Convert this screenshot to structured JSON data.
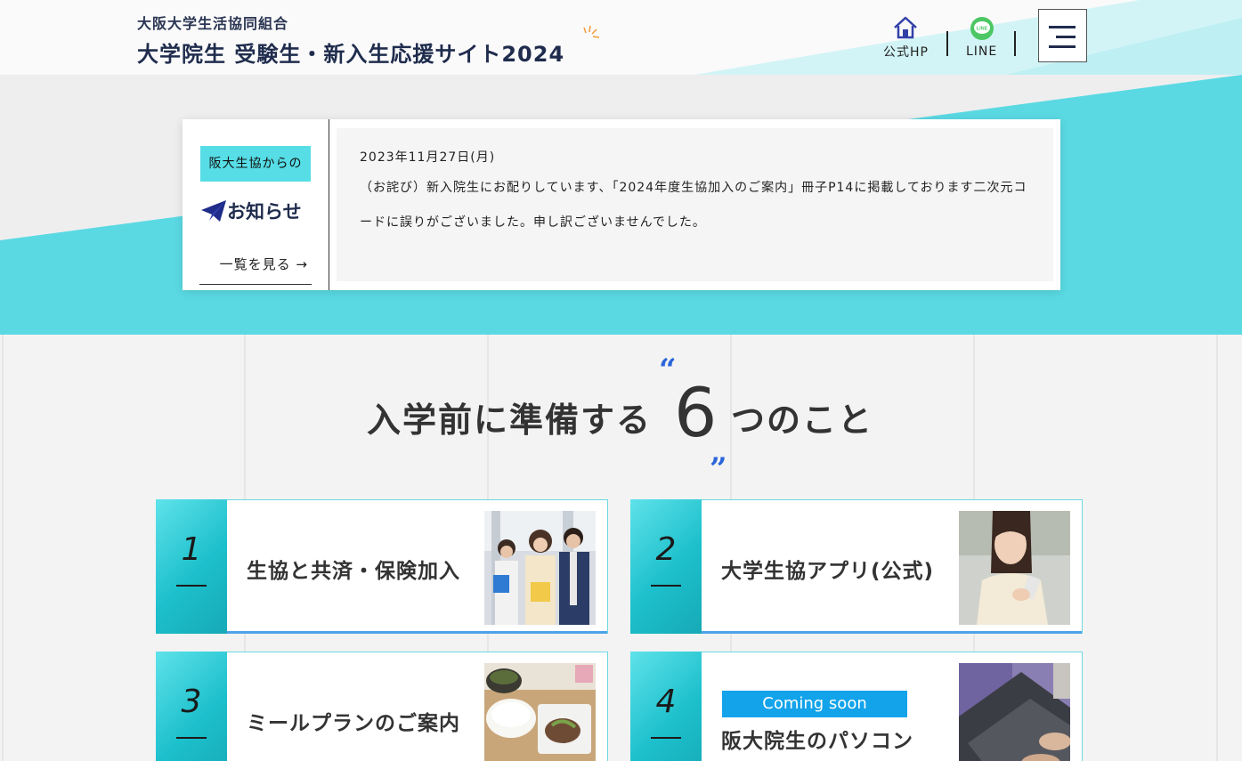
{
  "header": {
    "org_name": "大阪大学生活協同組合",
    "site_title": "大学院生 受験生・新入生応援サイト2024",
    "nav": {
      "official_hp_label": "公式HP",
      "line_label": "LINE",
      "line_icon_text": "LINE"
    }
  },
  "news": {
    "tag": "阪大生協からの",
    "title": "お知らせ",
    "more_label": "一覧を見る →",
    "date": "2023年11月27日(月)",
    "text": "（お詫び）新入院生にお配りしています、「2024年度生協加入のご案内」冊子P14に掲載しております二次元コードに誤りがございました。申し訳ございませんでした。"
  },
  "section": {
    "title_before": "入学前に準備する",
    "title_number": "6",
    "title_after": "つのこと",
    "quote_open": "“",
    "quote_close": "”"
  },
  "cards": [
    {
      "number": "1",
      "label": "生協と共済・保険加入",
      "badge": ""
    },
    {
      "number": "2",
      "label": "大学生協アプリ(公式)",
      "badge": ""
    },
    {
      "number": "3",
      "label": "ミールプランのご案内",
      "badge": ""
    },
    {
      "number": "4",
      "label": "阪大院生のパソコン",
      "badge": "Coming soon"
    }
  ],
  "colors": {
    "accent_cyan": "#56dde6",
    "navy": "#1f2c4d",
    "blue": "#2b66d9",
    "coming_soon": "#12a3ea",
    "line_green": "#4cc764"
  }
}
